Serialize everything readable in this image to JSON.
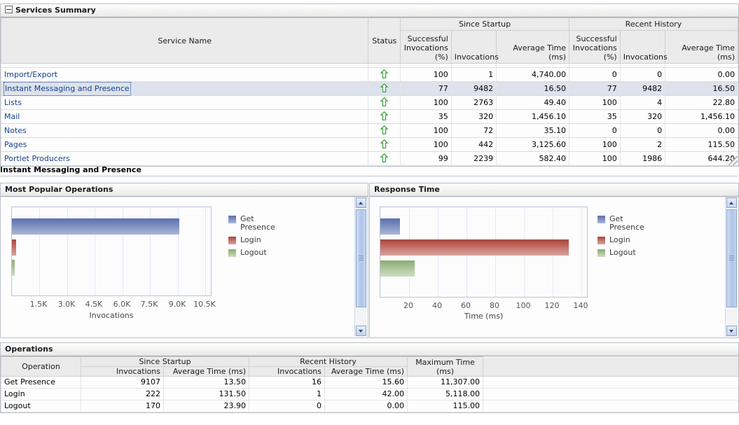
{
  "services_summary": {
    "title": "Services Summary",
    "collapse_icon": "minus-box-icon",
    "columns": {
      "service_name": "Service Name",
      "status": "Status",
      "since_startup": "Since Startup",
      "recent_history": "Recent History",
      "successful_invocations_pct": "Successful Invocations (%)",
      "invocations": "Invocations",
      "average_time_ms": "Average Time (ms)"
    },
    "status_icon": "status-up-arrow-icon",
    "rows": [
      {
        "name": "Import/Export",
        "status": "up",
        "ss_pct": "100",
        "ss_inv": "1",
        "ss_avg": "4,740.00",
        "rh_pct": "0",
        "rh_inv": "0",
        "rh_avg": "0.00",
        "selected": false
      },
      {
        "name": "Instant Messaging and Presence",
        "status": "up",
        "ss_pct": "77",
        "ss_inv": "9482",
        "ss_avg": "16.50",
        "rh_pct": "77",
        "rh_inv": "9482",
        "rh_avg": "16.50",
        "selected": true
      },
      {
        "name": "Lists",
        "status": "up",
        "ss_pct": "100",
        "ss_inv": "2763",
        "ss_avg": "49.40",
        "rh_pct": "100",
        "rh_inv": "4",
        "rh_avg": "22.80",
        "selected": false
      },
      {
        "name": "Mail",
        "status": "up",
        "ss_pct": "35",
        "ss_inv": "320",
        "ss_avg": "1,456.10",
        "rh_pct": "35",
        "rh_inv": "320",
        "rh_avg": "1,456.10",
        "selected": false
      },
      {
        "name": "Notes",
        "status": "up",
        "ss_pct": "100",
        "ss_inv": "72",
        "ss_avg": "35.10",
        "rh_pct": "0",
        "rh_inv": "0",
        "rh_avg": "0.00",
        "selected": false
      },
      {
        "name": "Pages",
        "status": "up",
        "ss_pct": "100",
        "ss_inv": "442",
        "ss_avg": "3,125.60",
        "rh_pct": "100",
        "rh_inv": "2",
        "rh_avg": "115.50",
        "selected": false
      },
      {
        "name": "Portlet Producers",
        "status": "up",
        "ss_pct": "99",
        "ss_inv": "2239",
        "ss_avg": "582.40",
        "rh_pct": "100",
        "rh_inv": "1986",
        "rh_avg": "644.20",
        "selected": false
      }
    ]
  },
  "sub_title": "Instant Messaging and Presence",
  "most_popular_operations": {
    "title": "Most Popular Operations",
    "scrollbar": "vertical-scrollbar"
  },
  "response_time": {
    "title": "Response Time",
    "scrollbar": "vertical-scrollbar"
  },
  "chart_data": [
    {
      "type": "bar",
      "orientation": "horizontal",
      "title": "Most Popular Operations",
      "categories": [
        "Get Presence",
        "Login",
        "Logout"
      ],
      "values": [
        9107,
        222,
        170
      ],
      "series": [
        {
          "name": "Invocations",
          "values": [
            9107,
            222,
            170
          ]
        }
      ],
      "legend": [
        "Get Presence",
        "Login",
        "Logout"
      ],
      "legend_position": "right",
      "colors": [
        "#5b6fae",
        "#a9453e",
        "#8aab72"
      ],
      "xlabel": "Invocations",
      "ylabel": "",
      "xticks": [
        "1.5K",
        "3.0K",
        "4.5K",
        "6.0K",
        "7.5K",
        "9.0K",
        "10.5K"
      ],
      "xtick_values": [
        1500,
        3000,
        4500,
        6000,
        7500,
        9000,
        10500
      ],
      "xlim": [
        0,
        10800
      ],
      "grid": true
    },
    {
      "type": "bar",
      "orientation": "horizontal",
      "title": "Response Time",
      "categories": [
        "Get Presence",
        "Login",
        "Logout"
      ],
      "values": [
        13.5,
        131.5,
        23.9
      ],
      "series": [
        {
          "name": "Time (ms)",
          "values": [
            13.5,
            131.5,
            23.9
          ]
        }
      ],
      "legend": [
        "Get Presence",
        "Login",
        "Logout"
      ],
      "legend_position": "right",
      "colors": [
        "#5b6fae",
        "#a9453e",
        "#8aab72"
      ],
      "xlabel": "Time (ms)",
      "ylabel": "",
      "xticks": [
        "20",
        "40",
        "60",
        "80",
        "100",
        "120",
        "140"
      ],
      "xtick_values": [
        20,
        40,
        60,
        80,
        100,
        120,
        140
      ],
      "xlim": [
        0,
        144
      ],
      "grid": true
    }
  ],
  "operations": {
    "title": "Operations",
    "columns": {
      "operation": "Operation",
      "since_startup": "Since Startup",
      "recent_history": "Recent History",
      "invocations": "Invocations",
      "average_time_ms": "Average Time (ms)",
      "maximum_time_ms": "Maximum Time (ms)"
    },
    "rows": [
      {
        "op": "Get Presence",
        "ss_inv": "9107",
        "ss_avg": "13.50",
        "rh_inv": "16",
        "rh_avg": "15.60",
        "max": "11,307.00"
      },
      {
        "op": "Login",
        "ss_inv": "222",
        "ss_avg": "131.50",
        "rh_inv": "1",
        "rh_avg": "42.00",
        "max": "5,118.00"
      },
      {
        "op": "Logout",
        "ss_inv": "170",
        "ss_avg": "23.90",
        "rh_inv": "0",
        "rh_avg": "0.00",
        "max": "115.00"
      }
    ]
  }
}
